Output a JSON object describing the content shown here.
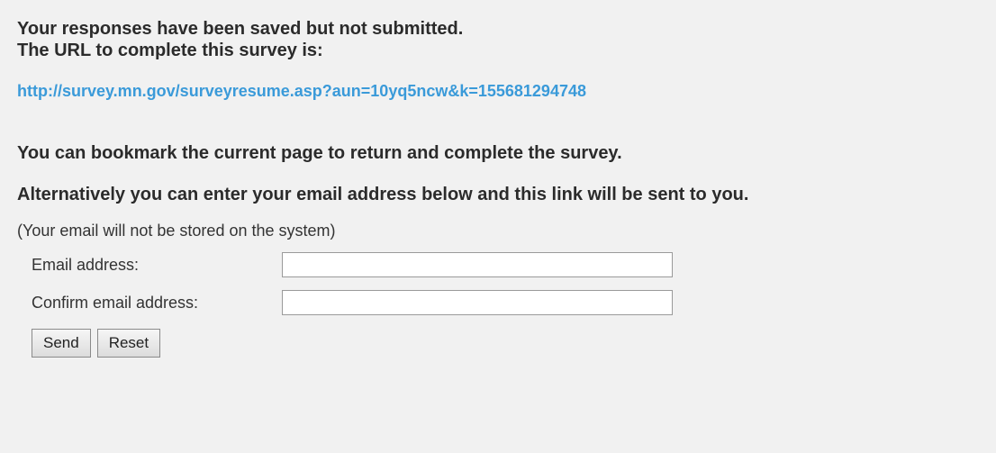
{
  "messages": {
    "saved_line1": "Your responses have been saved but not submitted.",
    "saved_line2": "The URL to complete this survey is:",
    "resume_url": "http://survey.mn.gov/surveyresume.asp?aun=10yq5ncw&k=155681294748",
    "bookmark": "You can bookmark the current page to return and complete the survey.",
    "alternative": "Alternatively you can enter your email address below and this link will be sent to you.",
    "privacy_note": "(Your email will not be stored on the system)"
  },
  "form": {
    "email_label": "Email address:",
    "email_value": "",
    "confirm_label": "Confirm email address:",
    "confirm_value": "",
    "send_label": "Send",
    "reset_label": "Reset"
  },
  "colors": {
    "background": "#f1f1f1",
    "link": "#3a9ad9",
    "text": "#2b2b2b"
  }
}
